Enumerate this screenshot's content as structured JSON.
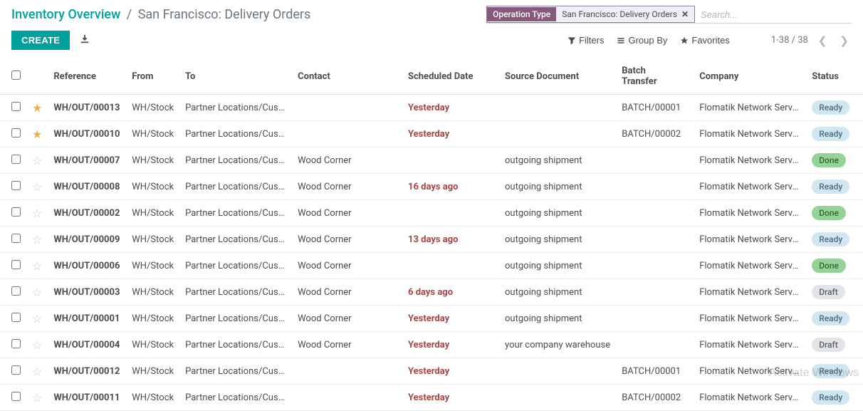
{
  "breadcrumb": {
    "root": "Inventory Overview",
    "current": "San Francisco: Delivery Orders"
  },
  "search": {
    "facet_label": "Operation Type",
    "facet_value": "San Francisco: Delivery Orders",
    "placeholder": "Search..."
  },
  "buttons": {
    "create": "CREATE",
    "filters": "Filters",
    "groupby": "Group By",
    "favorites": "Favorites"
  },
  "pager": {
    "range": "1-38",
    "sep": "/",
    "total": "38"
  },
  "columns": {
    "reference": "Reference",
    "from": "From",
    "to": "To",
    "contact": "Contact",
    "scheduled": "Scheduled Date",
    "source": "Source Document",
    "batch": "Batch Transfer",
    "company": "Company",
    "status": "Status"
  },
  "rows": [
    {
      "star": true,
      "ref": "WH/OUT/00013",
      "from": "WH/Stock",
      "to": "Partner Locations/Cust...",
      "contact": "",
      "sched": "Yesterday",
      "sched_red": true,
      "source": "",
      "batch": "BATCH/00001",
      "company": "Flomatik Network Servi...",
      "status": "Ready"
    },
    {
      "star": true,
      "ref": "WH/OUT/00010",
      "from": "WH/Stock",
      "to": "Partner Locations/Cust...",
      "contact": "",
      "sched": "Yesterday",
      "sched_red": true,
      "source": "",
      "batch": "BATCH/00002",
      "company": "Flomatik Network Servi...",
      "status": "Ready"
    },
    {
      "star": false,
      "ref": "WH/OUT/00007",
      "from": "WH/Stock",
      "to": "Partner Locations/Cust...",
      "contact": "Wood Corner",
      "sched": "",
      "sched_red": false,
      "source": "outgoing shipment",
      "batch": "",
      "company": "Flomatik Network Servic...",
      "status": "Done"
    },
    {
      "star": false,
      "ref": "WH/OUT/00008",
      "from": "WH/Stock",
      "to": "Partner Locations/Cust...",
      "contact": "Wood Corner",
      "sched": "16 days ago",
      "sched_red": true,
      "source": "outgoing shipment",
      "batch": "",
      "company": "Flomatik Network Servi...",
      "status": "Ready"
    },
    {
      "star": false,
      "ref": "WH/OUT/00002",
      "from": "WH/Stock",
      "to": "Partner Locations/Cust...",
      "contact": "Wood Corner",
      "sched": "",
      "sched_red": false,
      "source": "outgoing shipment",
      "batch": "",
      "company": "Flomatik Network Servic...",
      "status": "Done"
    },
    {
      "star": false,
      "ref": "WH/OUT/00009",
      "from": "WH/Stock",
      "to": "Partner Locations/Cust...",
      "contact": "Wood Corner",
      "sched": "13 days ago",
      "sched_red": true,
      "source": "outgoing shipment",
      "batch": "",
      "company": "Flomatik Network Servi...",
      "status": "Ready"
    },
    {
      "star": false,
      "ref": "WH/OUT/00006",
      "from": "WH/Stock",
      "to": "Partner Locations/Cust...",
      "contact": "Wood Corner",
      "sched": "",
      "sched_red": false,
      "source": "outgoing shipment",
      "batch": "",
      "company": "Flomatik Network Servic...",
      "status": "Done"
    },
    {
      "star": false,
      "ref": "WH/OUT/00003",
      "from": "WH/Stock",
      "to": "Partner Locations/Cust...",
      "contact": "Wood Corner",
      "sched": "6 days ago",
      "sched_red": true,
      "source": "outgoing shipment",
      "batch": "",
      "company": "Flomatik Network Servi...",
      "status": "Draft"
    },
    {
      "star": false,
      "ref": "WH/OUT/00001",
      "from": "WH/Stock",
      "to": "Partner Locations/Cust...",
      "contact": "Wood Corner",
      "sched": "Yesterday",
      "sched_red": true,
      "source": "outgoing shipment",
      "batch": "",
      "company": "Flomatik Network Servi...",
      "status": "Ready"
    },
    {
      "star": false,
      "ref": "WH/OUT/00004",
      "from": "WH/Stock",
      "to": "Partner Locations/Cust...",
      "contact": "Wood Corner",
      "sched": "Yesterday",
      "sched_red": true,
      "source": "your company warehouse",
      "batch": "",
      "company": "Flomatik Network Servi...",
      "status": "Draft"
    },
    {
      "star": false,
      "ref": "WH/OUT/00012",
      "from": "WH/Stock",
      "to": "Partner Locations/Cust...",
      "contact": "",
      "sched": "Yesterday",
      "sched_red": true,
      "source": "",
      "batch": "BATCH/00001",
      "company": "Flomatik Network Servi...",
      "status": "Ready"
    },
    {
      "star": false,
      "ref": "WH/OUT/00011",
      "from": "WH/Stock",
      "to": "Partner Locations/Cust...",
      "contact": "",
      "sched": "Yesterday",
      "sched_red": true,
      "source": "",
      "batch": "BATCH/00002",
      "company": "Flomatik Network Servi...",
      "status": "Ready"
    }
  ],
  "watermark": "Activate Windows"
}
